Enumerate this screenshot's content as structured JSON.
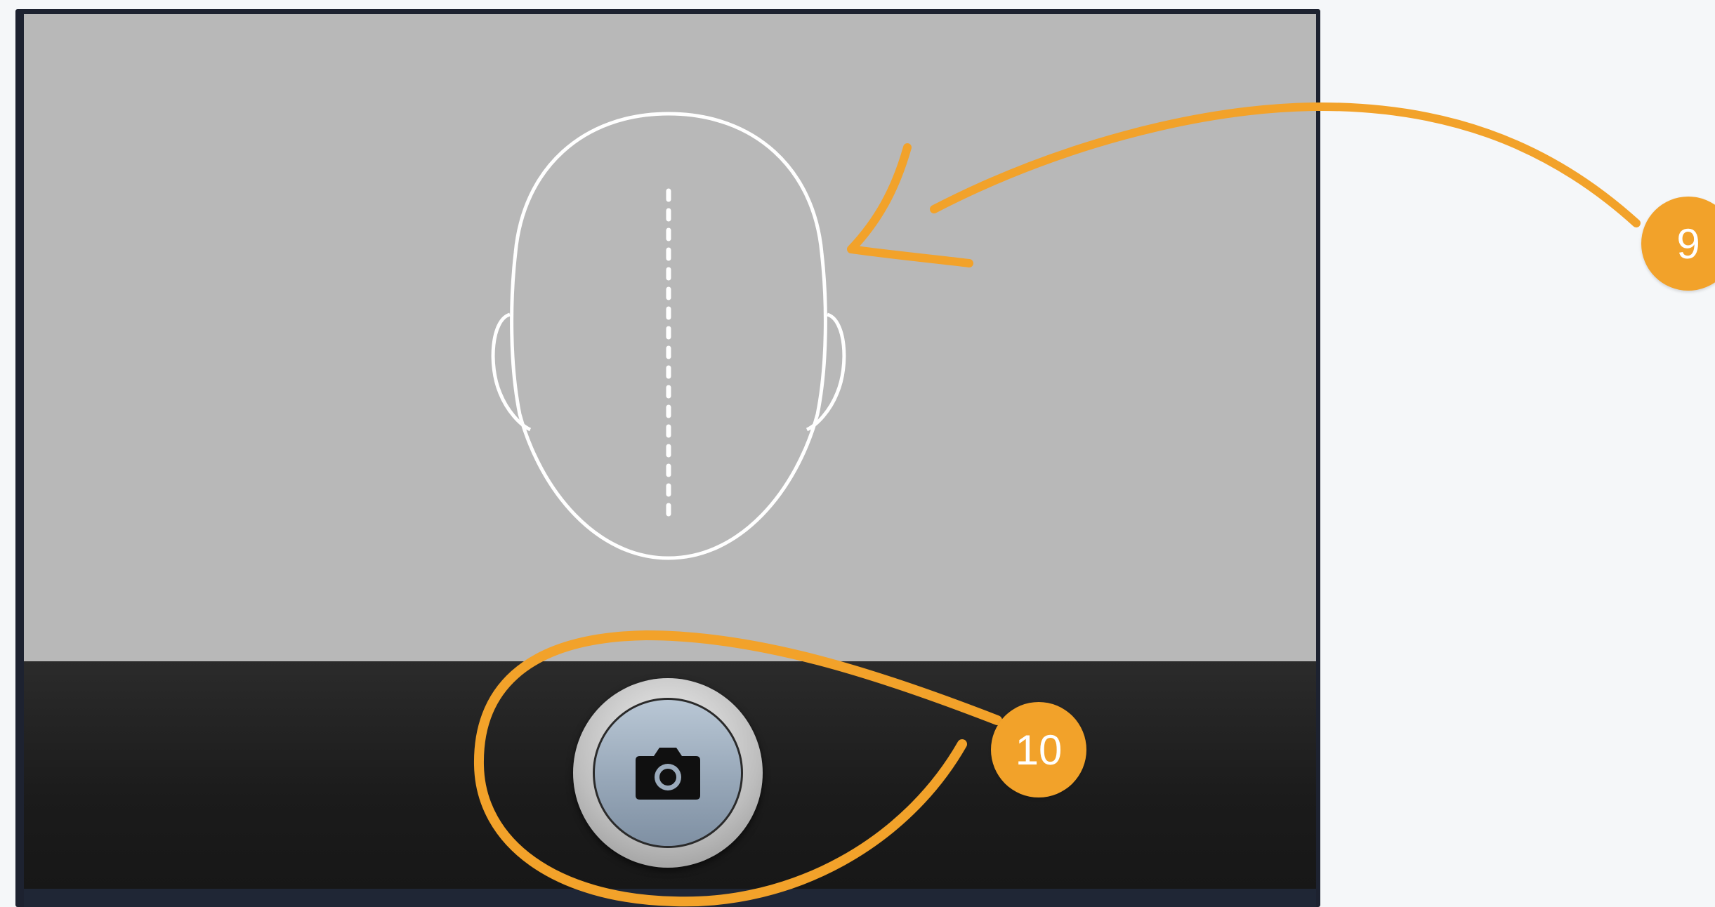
{
  "screen": {
    "viewfinder_bg": "#b8b8b8",
    "control_bar_bg": "#1b1b1b",
    "guide_stroke": "#ffffff"
  },
  "controls": {
    "shutter_icon": "camera-icon"
  },
  "annotations": {
    "accent": "#f2a22a",
    "callouts": [
      {
        "label": "9",
        "target": "face-guide-outline"
      },
      {
        "label": "10",
        "target": "shutter-button"
      }
    ]
  }
}
